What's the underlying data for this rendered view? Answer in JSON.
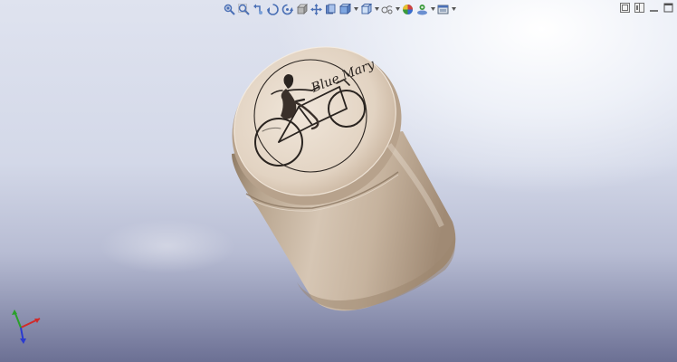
{
  "toolbar": {
    "buttons": [
      {
        "name": "zoom-to-fit-icon",
        "color": "#4a6fb5"
      },
      {
        "name": "zoom-to-area-icon",
        "color": "#4a6fb5"
      },
      {
        "name": "previous-view-icon",
        "color": "#4a6fb5"
      },
      {
        "name": "section-view-icon",
        "color": "#4a6fb5"
      },
      {
        "name": "dynamic-annotation-icon",
        "color": "#4a6fb5"
      },
      {
        "name": "view-orientation-icon",
        "color": "#6a6a6a"
      },
      {
        "name": "rotate-icon",
        "color": "#4a6fb5"
      },
      {
        "name": "pan-icon",
        "color": "#4a6fb5"
      },
      {
        "name": "display-style-icon",
        "color": "#4a6fb5"
      },
      {
        "name": "hide-show-items-icon",
        "color": "#8a6a3a"
      },
      {
        "name": "edit-appearance-icon",
        "color": "#d04040"
      },
      {
        "name": "apply-scene-icon",
        "color": "#3a9a3a"
      },
      {
        "name": "view-settings-icon",
        "color": "#4a6fb5"
      }
    ]
  },
  "window_controls": [
    "tile-horizontal-icon",
    "tile-vertical-icon",
    "minimize-icon",
    "maximize-icon"
  ],
  "model": {
    "engraving_text": "Blue Mary",
    "colors": {
      "body": "#c8b5a0",
      "shadow": "#8e7a66",
      "highlight": "#e8dbcc"
    }
  },
  "triad": {
    "x_color": "#d02a2a",
    "y_color": "#2aa02a",
    "z_color": "#2a3ad0"
  }
}
